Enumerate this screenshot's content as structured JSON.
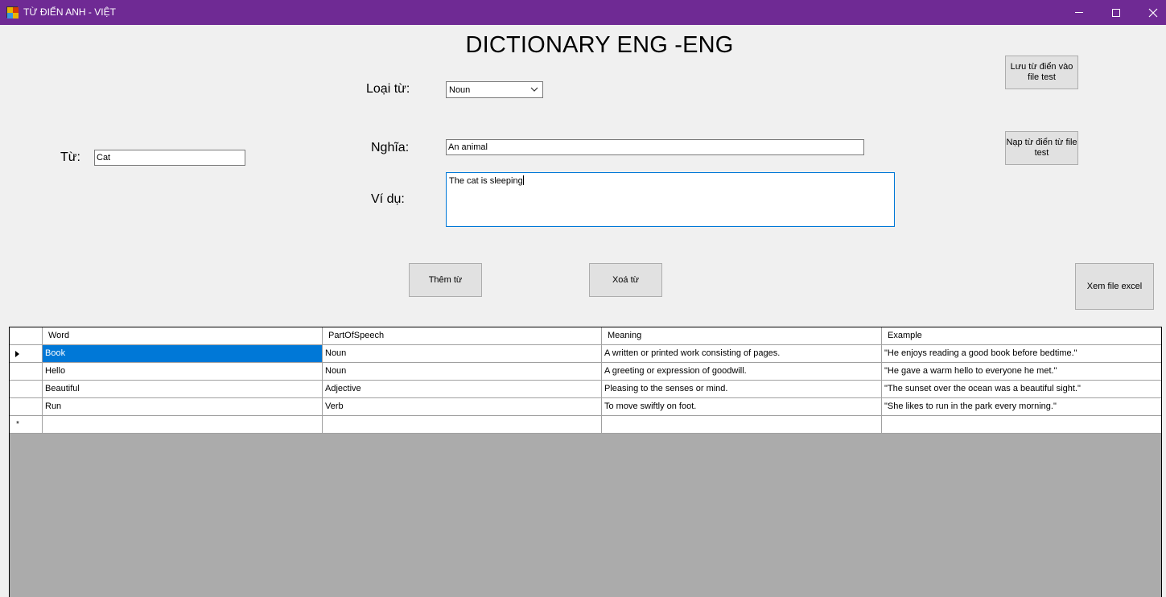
{
  "window": {
    "title": "TỪ ĐIỂN ANH - VIỆT",
    "icon": "app-grid-icon",
    "controls": [
      "minimize-icon",
      "maximize-icon",
      "close-icon"
    ]
  },
  "heading": "DICTIONARY ENG -ENG",
  "form": {
    "word_label": "Từ:",
    "word_value": "Cat",
    "type_label": "Loại từ:",
    "type_selected": "Noun",
    "meaning_label": "Nghĩa:",
    "meaning_value": "An animal",
    "example_label": "Ví dụ:",
    "example_value": "The cat is sleeping"
  },
  "buttons": {
    "save_to_file": "Lưu từ điển vào file test",
    "load_from_file": "Nạp từ điển từ file test",
    "add_word": "Thêm từ",
    "delete_word": "Xoá từ",
    "view_excel": "Xem file excel"
  },
  "grid": {
    "columns": [
      "Word",
      "PartOfSpeech",
      "Meaning",
      "Example"
    ],
    "rows": [
      [
        "Book",
        "Noun",
        "A written or printed work consisting of pages.",
        "\"He enjoys reading a good book before bedtime.\""
      ],
      [
        "Hello",
        "Noun",
        "A greeting or expression of goodwill.",
        "\"He gave a warm hello to everyone he met.\""
      ],
      [
        "Beautiful",
        "Adjective",
        "Pleasing to the senses or mind.",
        "\"The sunset over the ocean was a beautiful sight.\""
      ],
      [
        "Run",
        "Verb",
        "To move swiftly on foot.",
        "\"She likes to run in the park every morning.\""
      ]
    ],
    "new_row_marker": "*",
    "selected_row": 0
  },
  "colors": {
    "titlebar": "#6f2a94",
    "selection": "#0078d7",
    "grid_background": "#ababab"
  }
}
